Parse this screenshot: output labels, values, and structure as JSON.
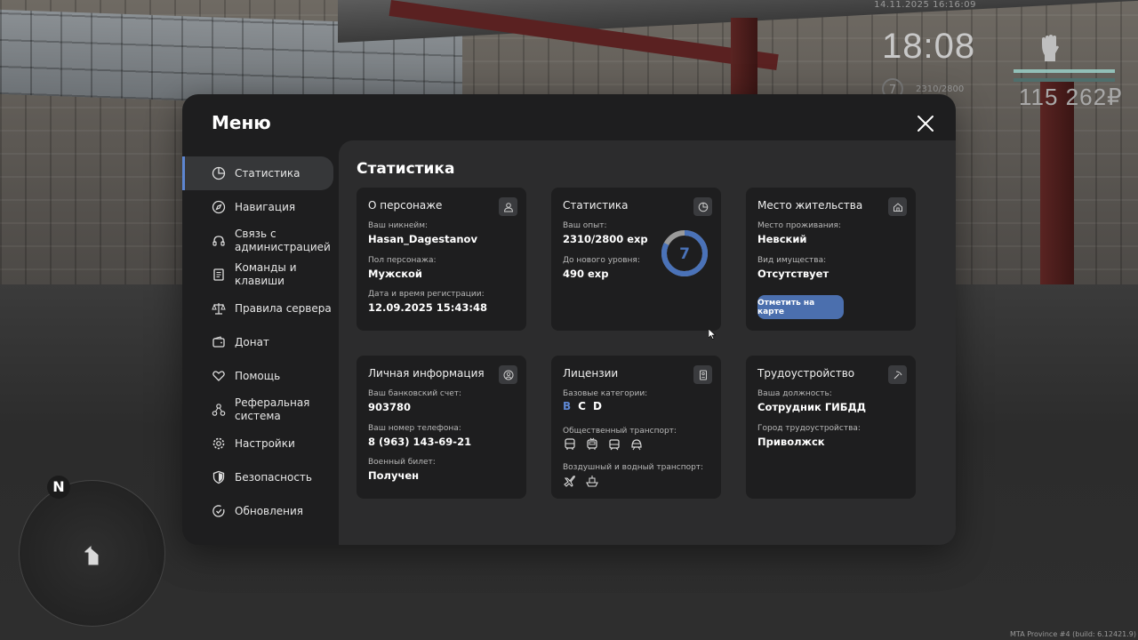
{
  "hud": {
    "datetime": "14.11.2025 16:16:09",
    "clock": "18:08",
    "level": "7",
    "exp": "2310/2800",
    "money": "115 262₽",
    "minimap_north": "N",
    "build": "MTA Province #4 (build: 6.12421.9)"
  },
  "menu": {
    "title": "Меню",
    "sidebar": [
      {
        "label": "Статистика",
        "icon": "pie-chart-icon",
        "active": true
      },
      {
        "label": "Навигация",
        "icon": "compass-icon"
      },
      {
        "label": "Связь с\nадминистрацией",
        "icon": "headset-icon"
      },
      {
        "label": "Команды и\nклавиши",
        "icon": "document-icon"
      },
      {
        "label": "Правила сервера",
        "icon": "scales-icon"
      },
      {
        "label": "Донат",
        "icon": "wallet-icon"
      },
      {
        "label": "Помощь",
        "icon": "heart-hands-icon"
      },
      {
        "label": "Реферальная\nсистема",
        "icon": "network-icon"
      },
      {
        "label": "Настройки",
        "icon": "gear-icon"
      },
      {
        "label": "Безопасность",
        "icon": "shield-icon"
      },
      {
        "label": "Обновления",
        "icon": "check-circle-icon"
      }
    ]
  },
  "content": {
    "title": "Статистика",
    "character": {
      "title": "О персонаже",
      "nickname_label": "Ваш никнейм:",
      "nickname": "Hasan_Dagestanov",
      "gender_label": "Пол персонажа:",
      "gender": "Мужской",
      "reg_label": "Дата и время регистрации:",
      "reg": "12.09.2025 15:43:48"
    },
    "stats": {
      "title": "Статистика",
      "exp_label": "Ваш опыт:",
      "exp": "2310/2800 exp",
      "next_label": "До нового уровня:",
      "next": "490 exp",
      "level": "7",
      "progress": 0.825
    },
    "residence": {
      "title": "Место жительства",
      "place_label": "Место проживания:",
      "place": "Невский",
      "property_label": "Вид имущества:",
      "property": "Отсутствует",
      "map_button": "Отметить на карте"
    },
    "personal": {
      "title": "Личная информация",
      "bank_label": "Ваш банковский счет:",
      "bank": "903780",
      "phone_label": "Ваш номер телефона:",
      "phone": "8 (963) 143-69-21",
      "military_label": "Военный билет:",
      "military": "Получен"
    },
    "licenses": {
      "title": "Лицензии",
      "base_label": "Базовые категории:",
      "categories": [
        "B",
        "C",
        "D"
      ],
      "public_label": "Общественный транспорт:",
      "air_label": "Воздушный и водный транспорт:"
    },
    "employment": {
      "title": "Трудоустройство",
      "position_label": "Ваша должность:",
      "position": "Сотрудник ГИБДД",
      "city_label": "Город трудоустройства:",
      "city": "Приволжск"
    }
  },
  "colors": {
    "accent": "#5d86d1",
    "button": "#4b6fae",
    "card": "#1e1e1f",
    "panel": "#2c2c2d",
    "category_active": "#5d86d1"
  }
}
